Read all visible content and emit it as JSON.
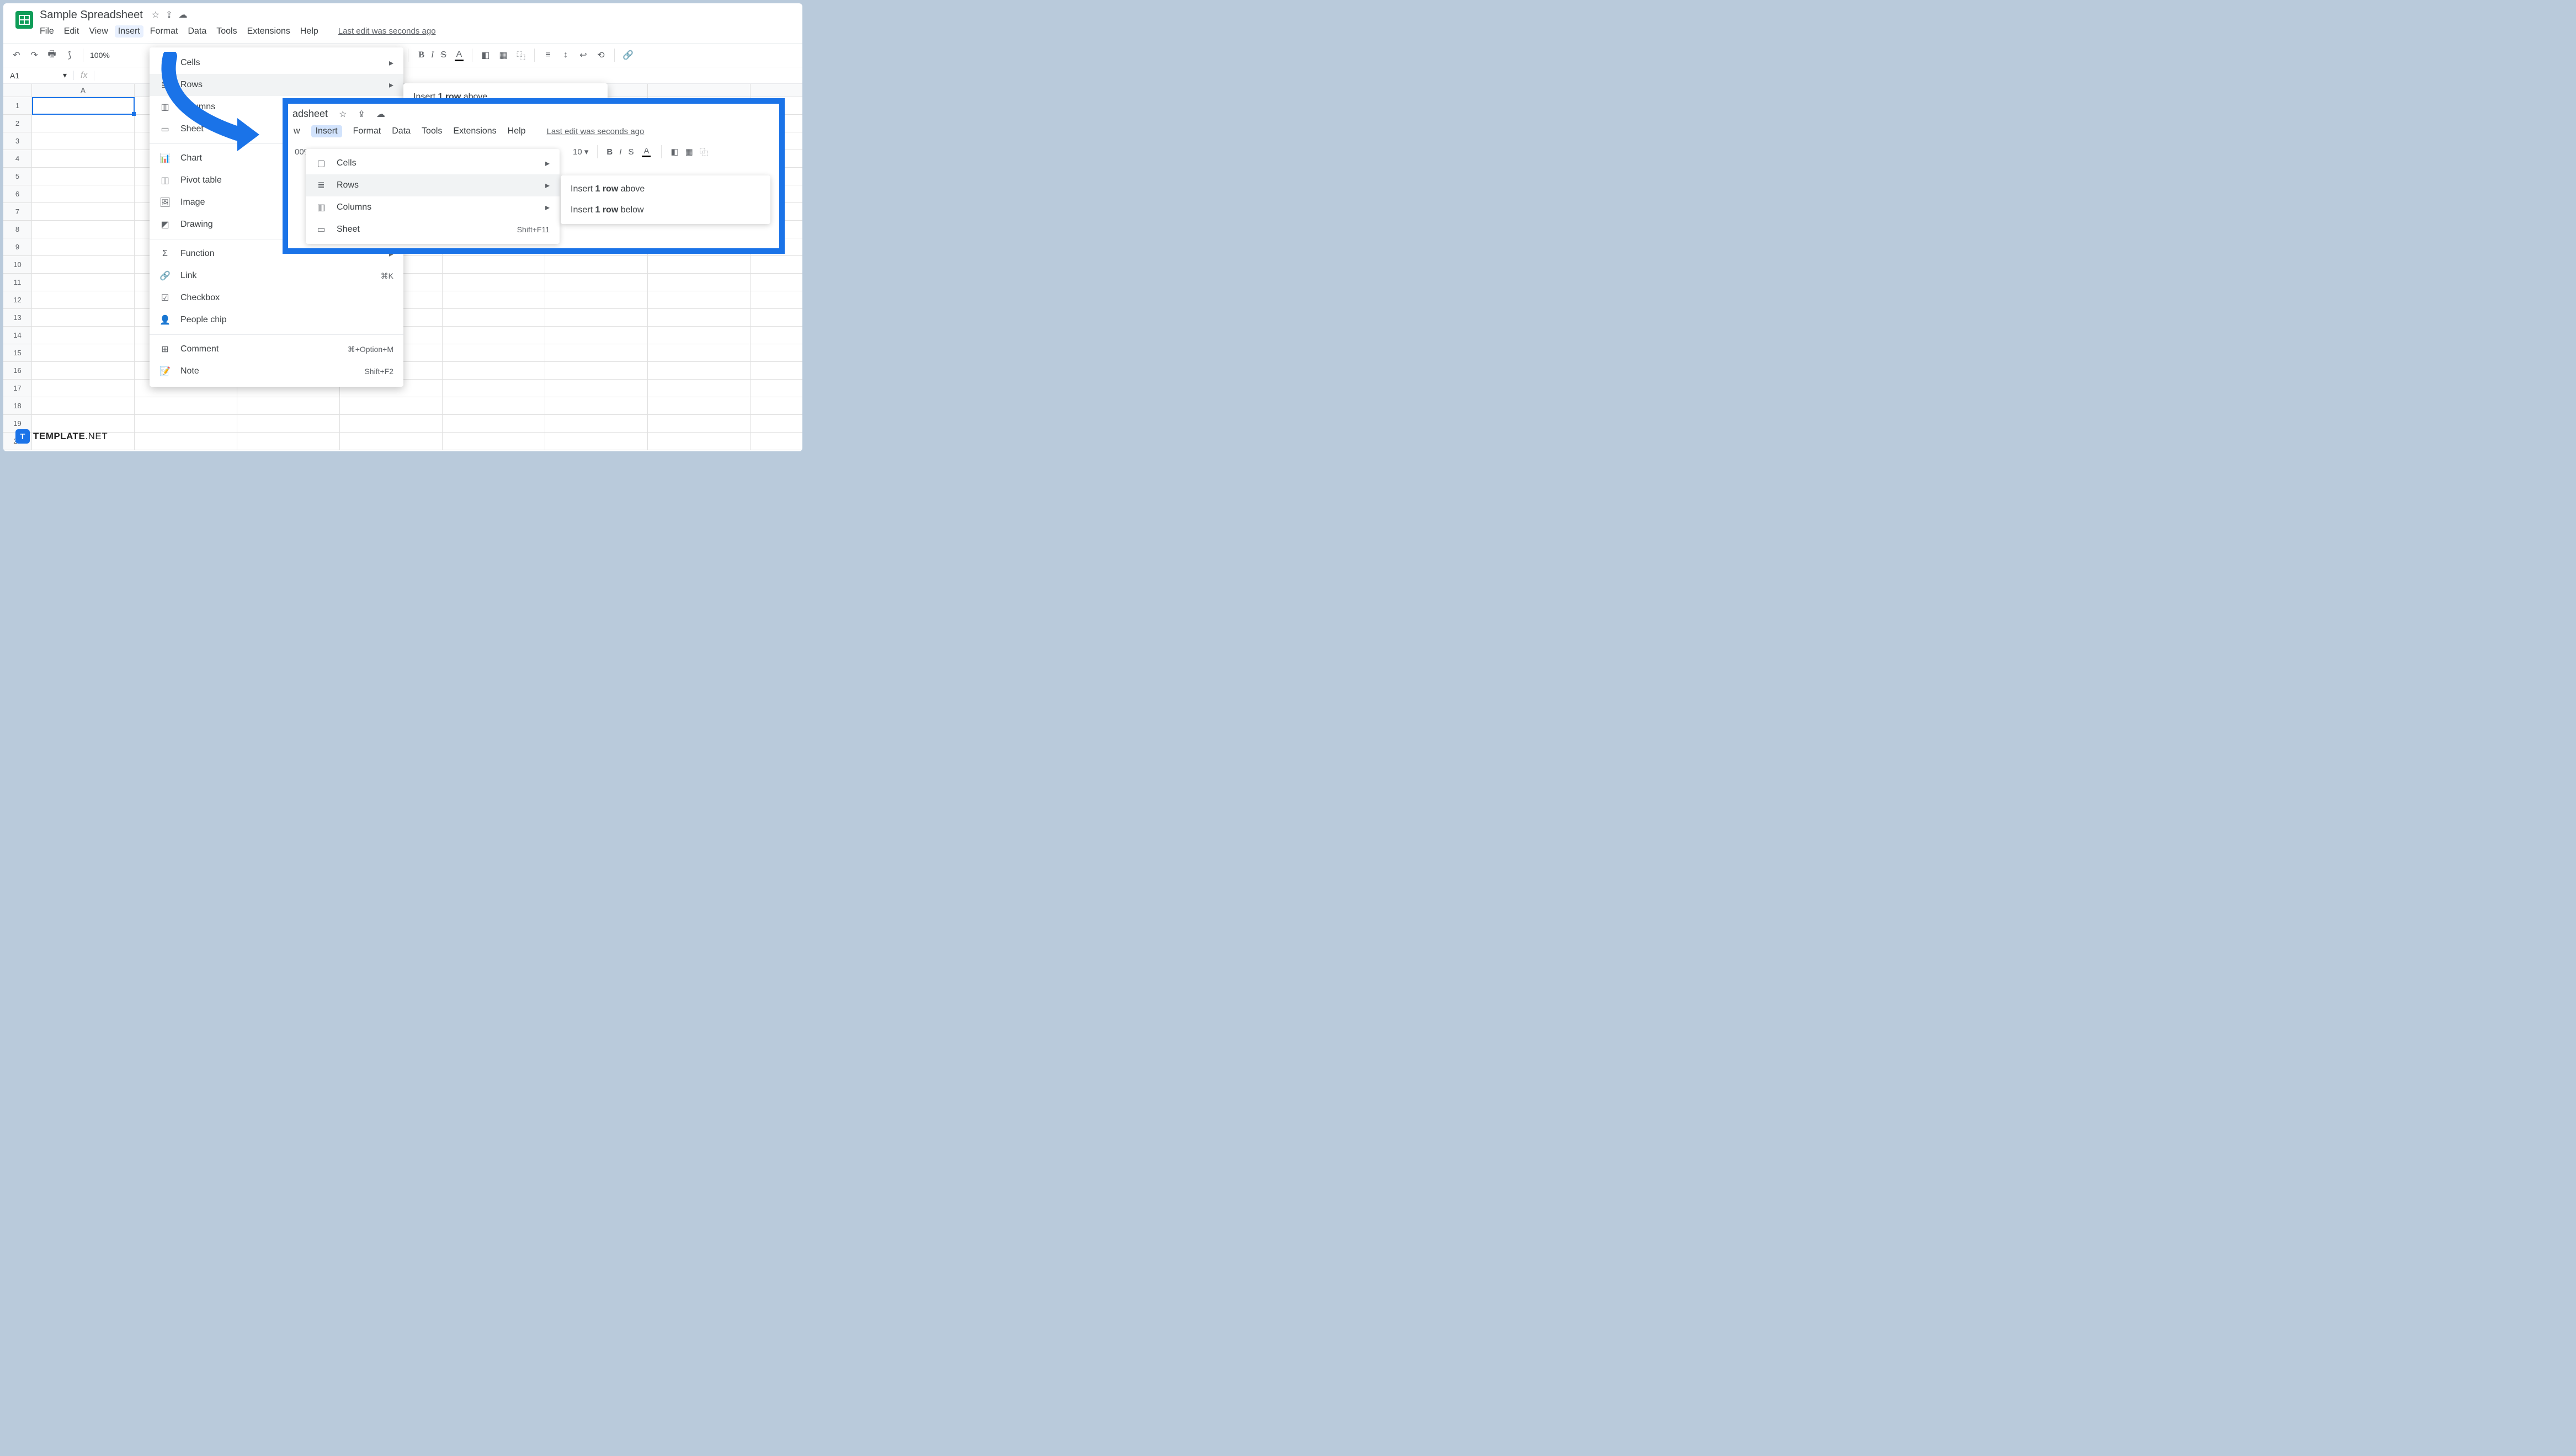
{
  "doc": {
    "title": "Sample Spreadsheet"
  },
  "menubar": {
    "file": "File",
    "edit": "Edit",
    "view": "View",
    "insert": "Insert",
    "format": "Format",
    "data": "Data",
    "tools": "Tools",
    "extensions": "Extensions",
    "help": "Help",
    "history": "Last edit was seconds ago"
  },
  "toolbar": {
    "zoom": "100%",
    "fontsize": "10"
  },
  "namebox": {
    "cell": "A1",
    "fx": "fx"
  },
  "columns": [
    "A"
  ],
  "dropdown": {
    "cells": "Cells",
    "rows": "Rows",
    "columns": "Columns",
    "sheet": "Sheet",
    "chart": "Chart",
    "pivot": "Pivot table",
    "image": "Image",
    "drawing": "Drawing",
    "function": "Function",
    "link": "Link",
    "link_sc": "⌘K",
    "checkbox": "Checkbox",
    "people": "People chip",
    "comment": "Comment",
    "comment_sc": "⌘+Option+M",
    "note": "Note",
    "note_sc": "Shift+F2"
  },
  "submenu": {
    "above_pre": "Insert ",
    "above_b": "1 row",
    "above_post": " above"
  },
  "callout": {
    "title": "adsheet",
    "menubar": {
      "view": "w",
      "insert": "Insert",
      "format": "Format",
      "data": "Data",
      "tools": "Tools",
      "extensions": "Extensions",
      "help": "Help",
      "history": "Last edit was seconds ago"
    },
    "tb": {
      "zoom": "00%",
      "fontsize": "10"
    },
    "dd": {
      "cells": "Cells",
      "rows": "Rows",
      "columns": "Columns",
      "sheet": "Sheet",
      "sheet_sc": "Shift+F11"
    },
    "sm": {
      "above_pre": "Insert ",
      "above_b": "1 row",
      "above_post": " above",
      "below_pre": "Insert ",
      "below_b": "1 row",
      "below_post": " below"
    }
  },
  "watermark": {
    "t": "T",
    "brand": "TEMPLATE",
    "net": ".NET"
  }
}
